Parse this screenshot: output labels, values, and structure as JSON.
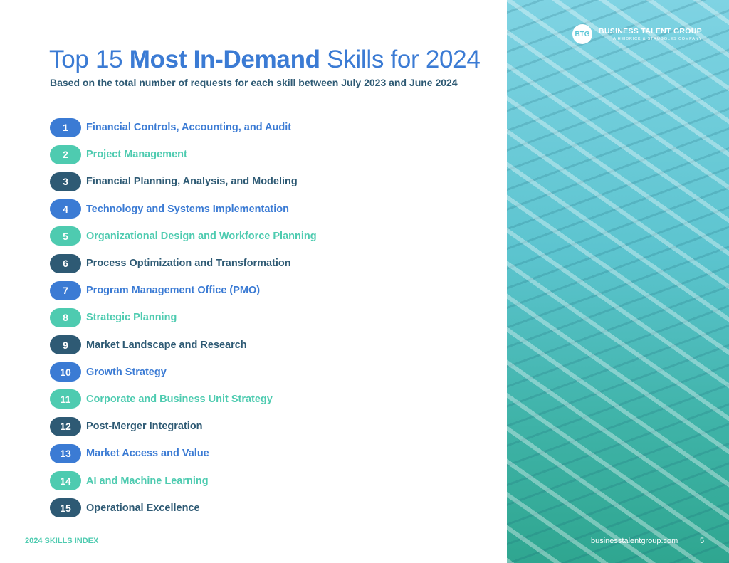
{
  "title": {
    "pre": "Top 15 ",
    "bold": "Most In-Demand",
    "post": " Skills for 2024"
  },
  "subtitle": "Based on the total number of requests for each skill between July 2023 and June 2024",
  "skills": [
    {
      "rank": "1",
      "label": "Financial Controls, Accounting, and Audit"
    },
    {
      "rank": "2",
      "label": "Project Management"
    },
    {
      "rank": "3",
      "label": "Financial Planning, Analysis, and Modeling"
    },
    {
      "rank": "4",
      "label": "Technology and Systems Implementation"
    },
    {
      "rank": "5",
      "label": "Organizational Design and Workforce Planning"
    },
    {
      "rank": "6",
      "label": "Process Optimization and Transformation"
    },
    {
      "rank": "7",
      "label": "Program Management Office (PMO)"
    },
    {
      "rank": "8",
      "label": "Strategic Planning"
    },
    {
      "rank": "9",
      "label": "Market Landscape and Research"
    },
    {
      "rank": "10",
      "label": "Growth Strategy"
    },
    {
      "rank": "11",
      "label": "Corporate and Business Unit Strategy"
    },
    {
      "rank": "12",
      "label": "Post-Merger Integration"
    },
    {
      "rank": "13",
      "label": "Market Access and Value"
    },
    {
      "rank": "14",
      "label": "AI and Machine Learning"
    },
    {
      "rank": "15",
      "label": "Operational Excellence"
    }
  ],
  "colors": [
    "#3b7bd4",
    "#4ecbb0",
    "#2e5a74"
  ],
  "logo": {
    "mark": "BTG",
    "name": "BUSINESS TALENT GROUP",
    "tagline": "A HEIDRICK & STRUGGLES COMPANY"
  },
  "footer": {
    "left": "2024 SKILLS INDEX",
    "url": "businesstalentgroup.com",
    "page": "5"
  }
}
